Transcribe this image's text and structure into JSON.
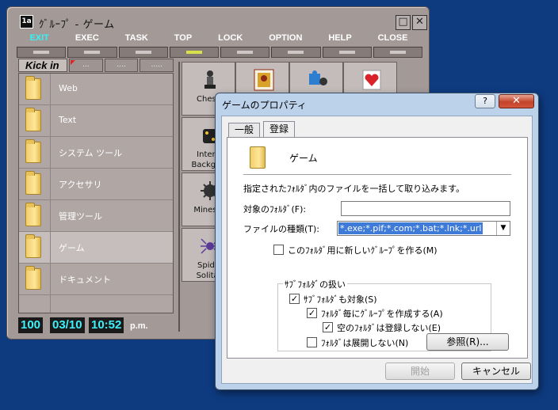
{
  "launcher": {
    "title": "ｸﾞﾙｰﾌﾟ - ゲーム",
    "app_icon_text": "1a",
    "maximize_glyph": "□",
    "close_glyph": "✕",
    "menu": [
      "EXIT",
      "EXEC",
      "TASK",
      "TOP",
      "LOCK",
      "OPTION",
      "HELP",
      "CLOSE"
    ],
    "kick_label": "Kick in",
    "kick_tabs": [
      "...",
      "....",
      "....."
    ],
    "groups": [
      "Web",
      "Text",
      "システム ツール",
      "アクセサリ",
      "管理ツール",
      "ゲーム",
      "ドキュメント"
    ],
    "status": {
      "count": "100",
      "date": "03/10",
      "time": "10:52",
      "ampm": "p.m."
    },
    "apps": [
      {
        "label": "Chess"
      },
      {
        "label": "Internet Backgammon",
        "lines": [
          "Intern",
          "Backgan"
        ]
      },
      {
        "label": "Minesweeper",
        "lines": [
          "Minesw"
        ]
      },
      {
        "label": "Spider Solitaire",
        "lines": [
          "Spide",
          "Solitai"
        ]
      }
    ]
  },
  "dialog": {
    "title": "ゲームのプロパティ",
    "help_glyph": "?",
    "close_glyph": "✕",
    "tabs": [
      "一般",
      "登録"
    ],
    "group_name": "ゲーム",
    "description": "指定されたﾌｫﾙﾀﾞ内のファイルを一括して取り込みます。",
    "target_folder_label": "対象のﾌｫﾙﾀﾞ(F):",
    "target_folder_value": "",
    "file_types_label": "ファイルの種類(T):",
    "file_types_value": "*.exe;*.pif;*.com;*.bat;*.lnk;*.url",
    "new_group_checkbox": {
      "label": "このﾌｫﾙﾀﾞ用に新しいｸﾞﾙｰﾌﾟを作る(M)",
      "checked": false
    },
    "subfolder_group_title": "ｻﾌﾞﾌｫﾙﾀﾞの扱い",
    "include_subfolders": {
      "label": "ｻﾌﾞﾌｫﾙﾀﾞも対象(S)",
      "checked": true
    },
    "group_per_folder": {
      "label": "ﾌｫﾙﾀﾞ毎にｸﾞﾙｰﾌﾟを作成する(A)",
      "checked": true
    },
    "skip_empty": {
      "label": "空のﾌｫﾙﾀﾞは登録しない(E)",
      "checked": true
    },
    "no_expand": {
      "label": "ﾌｫﾙﾀﾞは展開しない(N)",
      "checked": false
    },
    "browse_button": "参照(R)...",
    "start_button": "開始",
    "cancel_button": "キャンセル"
  }
}
